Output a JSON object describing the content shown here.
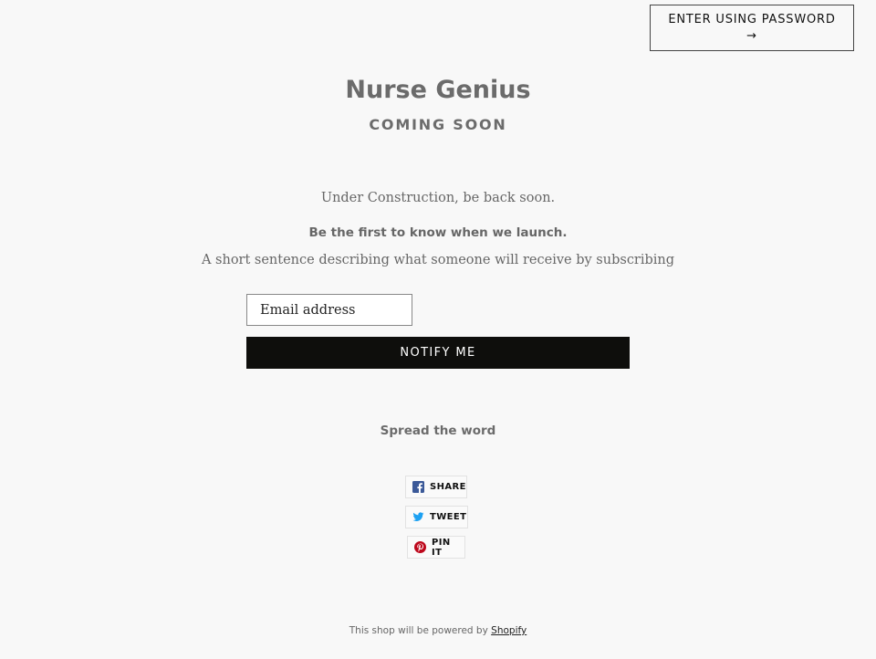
{
  "header": {
    "password_button_label": "ENTER USING PASSWORD",
    "password_button_arrow": "→"
  },
  "hero": {
    "title": "Nurse Genius",
    "subtitle": "COMING SOON"
  },
  "content": {
    "message": "Under Construction, be back soon.",
    "launch_heading": "Be the first to know when we launch.",
    "description": "A short sentence describing what someone will receive by subscribing"
  },
  "signup": {
    "email_placeholder": "Email address",
    "email_value": "",
    "notify_button_label": "NOTIFY ME"
  },
  "share": {
    "heading": "Spread the word",
    "buttons": [
      {
        "label": "SHARE",
        "icon": "facebook-icon",
        "color": "#3b5998"
      },
      {
        "label": "TWEET",
        "icon": "twitter-icon",
        "color": "#1da1f2"
      },
      {
        "label": "PIN IT",
        "icon": "pinterest-icon",
        "color": "#bd081c"
      }
    ]
  },
  "footer": {
    "text": "This shop will be powered by",
    "link_label": "Shopify"
  }
}
